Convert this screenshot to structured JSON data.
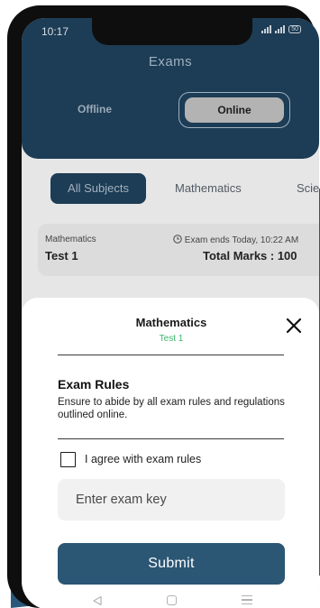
{
  "status_bar": {
    "time": "10:17",
    "battery": "50"
  },
  "header": {
    "title": "Exams",
    "modes": {
      "offline": "Offline",
      "online": "Online",
      "selected": "Online"
    }
  },
  "subject_tabs": [
    "All Subjects",
    "Mathematics",
    "Scie"
  ],
  "exam_card": {
    "subject": "Mathematics",
    "test_name": "Test 1",
    "ends": "Exam ends Today, 10:22 AM",
    "total_marks": "Total Marks : 100"
  },
  "sheet": {
    "title": "Mathematics",
    "subtitle": "Test 1",
    "rules_heading": "Exam Rules",
    "rules_text": "Ensure to abide by all exam rules and regulations outlined online.",
    "agree_label": "I agree with exam rules",
    "agree_checked": false,
    "key_placeholder": "Enter exam key",
    "key_value": "",
    "submit_label": "Submit"
  },
  "colors": {
    "primary": "#1d3c55",
    "button": "#2b5674",
    "accent_green": "#3db56b",
    "background_shape": "#2a587a"
  },
  "icons": [
    "clock-icon",
    "close-icon",
    "checkbox-icon",
    "nav-back-icon",
    "nav-home-icon",
    "nav-menu-icon",
    "signal-icon",
    "battery-icon"
  ]
}
